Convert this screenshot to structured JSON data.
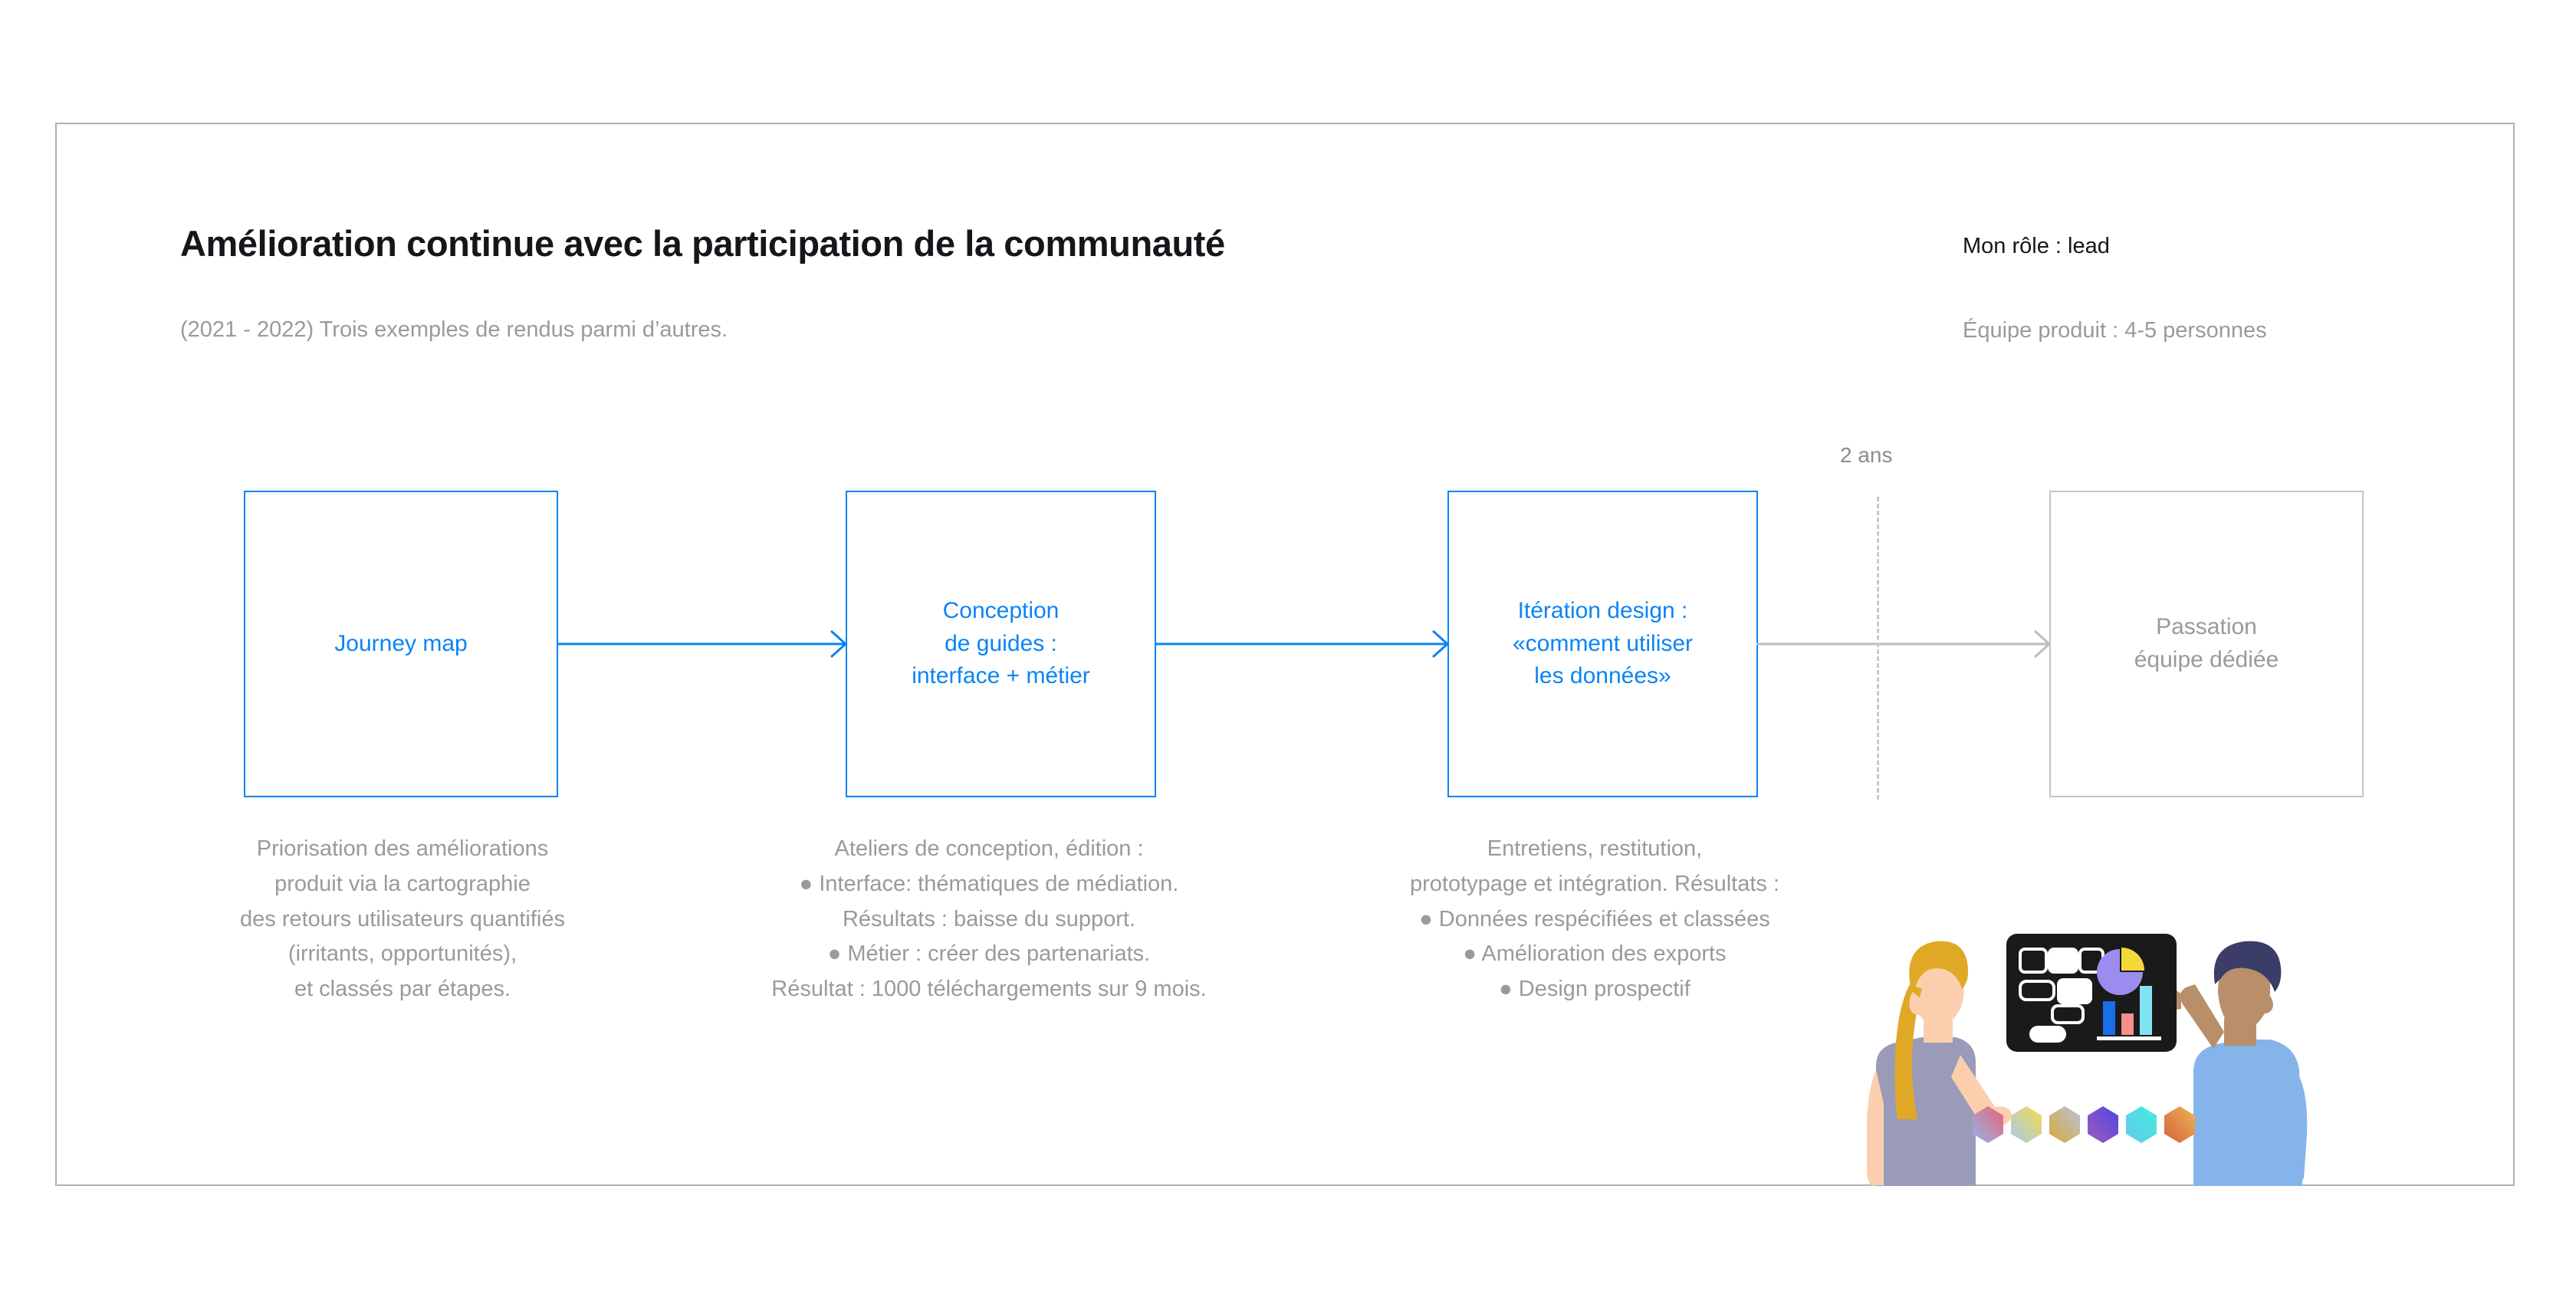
{
  "header": {
    "title": "Amélioration continue avec la participation de la communauté",
    "subtitle": "(2021 - 2022) Trois exemples de rendus parmi d’autres.",
    "role": "Mon rôle : lead",
    "team": "Équipe produit : 4-5 personnes"
  },
  "colors": {
    "accent_blue": "#0b84f3",
    "muted_gray": "#9a9a9a",
    "frame_gray": "#b0b0b0",
    "box_muted_border": "#c3c3c3",
    "text_dark": "#14161a"
  },
  "flow": {
    "divider_label": "2 ans",
    "steps": [
      {
        "id": "journey-map",
        "style": "accent",
        "lines": [
          "Journey map"
        ],
        "caption": [
          "Priorisation des améliorations",
          "produit via la cartographie",
          "des retours utilisateurs quantifiés",
          "(irritants, opportunités),",
          "et classés par étapes."
        ]
      },
      {
        "id": "conception-guides",
        "style": "accent",
        "lines": [
          "Conception",
          "de guides :",
          "interface + métier"
        ],
        "caption": [
          "Ateliers de conception, édition :",
          "● Interface: thématiques de médiation.",
          "Résultats : baisse du support.",
          "● Métier : créer des partenariats.",
          "Résultat : 1000 téléchargements sur 9 mois."
        ]
      },
      {
        "id": "iteration-design",
        "style": "accent",
        "lines": [
          "Itération design :",
          "«comment utiliser",
          "les données»"
        ],
        "caption": [
          "Entretiens, restitution,",
          "prototypage et intégration. Résultats :",
          "● Données respécifiées et classées",
          "● Amélioration des exports",
          "● Design prospectif"
        ]
      },
      {
        "id": "passation",
        "style": "muted",
        "lines": [
          "Passation",
          "équipe dédiée"
        ],
        "caption": []
      }
    ]
  },
  "illustration": {
    "name": "two-people-with-dashboard-illustration",
    "elements": [
      "woman-figure",
      "man-figure",
      "dashboard-panel",
      "pie-chart",
      "bar-chart",
      "hexagon-row"
    ],
    "hexagon_colors": [
      "#e8657f",
      "#eed44a",
      "#d1a93a",
      "#6a4bd8",
      "#45dfe0",
      "#e09040"
    ]
  }
}
